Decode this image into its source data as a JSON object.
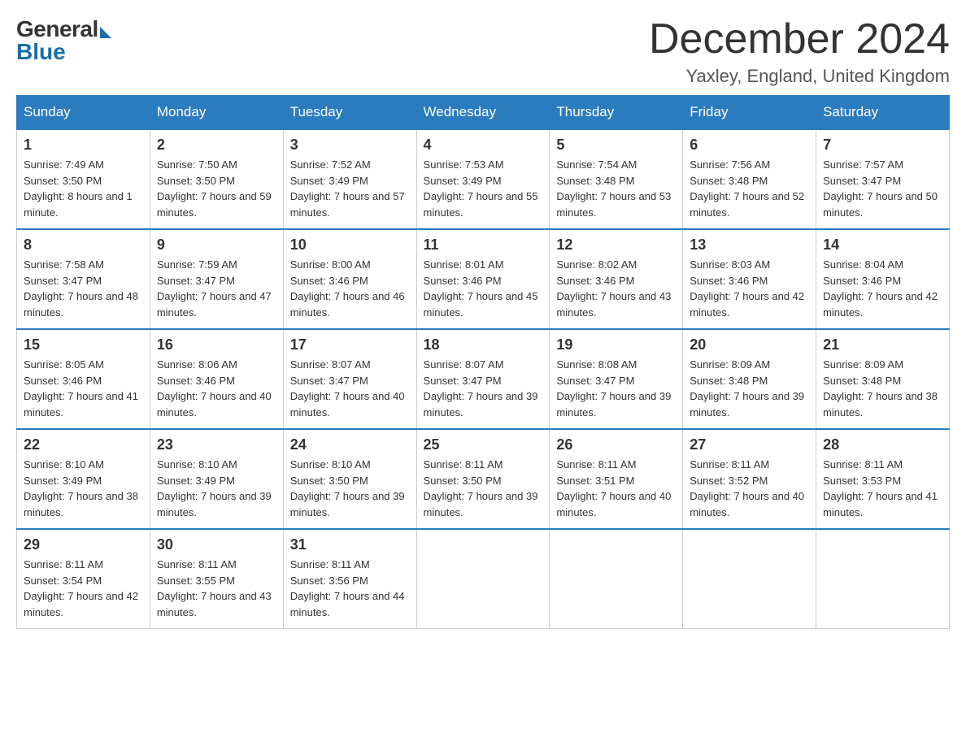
{
  "logo": {
    "general": "General",
    "blue": "Blue"
  },
  "title": "December 2024",
  "location": "Yaxley, England, United Kingdom",
  "days_of_week": [
    "Sunday",
    "Monday",
    "Tuesday",
    "Wednesday",
    "Thursday",
    "Friday",
    "Saturday"
  ],
  "weeks": [
    [
      {
        "num": "1",
        "sunrise": "7:49 AM",
        "sunset": "3:50 PM",
        "daylight": "8 hours and 1 minute."
      },
      {
        "num": "2",
        "sunrise": "7:50 AM",
        "sunset": "3:50 PM",
        "daylight": "7 hours and 59 minutes."
      },
      {
        "num": "3",
        "sunrise": "7:52 AM",
        "sunset": "3:49 PM",
        "daylight": "7 hours and 57 minutes."
      },
      {
        "num": "4",
        "sunrise": "7:53 AM",
        "sunset": "3:49 PM",
        "daylight": "7 hours and 55 minutes."
      },
      {
        "num": "5",
        "sunrise": "7:54 AM",
        "sunset": "3:48 PM",
        "daylight": "7 hours and 53 minutes."
      },
      {
        "num": "6",
        "sunrise": "7:56 AM",
        "sunset": "3:48 PM",
        "daylight": "7 hours and 52 minutes."
      },
      {
        "num": "7",
        "sunrise": "7:57 AM",
        "sunset": "3:47 PM",
        "daylight": "7 hours and 50 minutes."
      }
    ],
    [
      {
        "num": "8",
        "sunrise": "7:58 AM",
        "sunset": "3:47 PM",
        "daylight": "7 hours and 48 minutes."
      },
      {
        "num": "9",
        "sunrise": "7:59 AM",
        "sunset": "3:47 PM",
        "daylight": "7 hours and 47 minutes."
      },
      {
        "num": "10",
        "sunrise": "8:00 AM",
        "sunset": "3:46 PM",
        "daylight": "7 hours and 46 minutes."
      },
      {
        "num": "11",
        "sunrise": "8:01 AM",
        "sunset": "3:46 PM",
        "daylight": "7 hours and 45 minutes."
      },
      {
        "num": "12",
        "sunrise": "8:02 AM",
        "sunset": "3:46 PM",
        "daylight": "7 hours and 43 minutes."
      },
      {
        "num": "13",
        "sunrise": "8:03 AM",
        "sunset": "3:46 PM",
        "daylight": "7 hours and 42 minutes."
      },
      {
        "num": "14",
        "sunrise": "8:04 AM",
        "sunset": "3:46 PM",
        "daylight": "7 hours and 42 minutes."
      }
    ],
    [
      {
        "num": "15",
        "sunrise": "8:05 AM",
        "sunset": "3:46 PM",
        "daylight": "7 hours and 41 minutes."
      },
      {
        "num": "16",
        "sunrise": "8:06 AM",
        "sunset": "3:46 PM",
        "daylight": "7 hours and 40 minutes."
      },
      {
        "num": "17",
        "sunrise": "8:07 AM",
        "sunset": "3:47 PM",
        "daylight": "7 hours and 40 minutes."
      },
      {
        "num": "18",
        "sunrise": "8:07 AM",
        "sunset": "3:47 PM",
        "daylight": "7 hours and 39 minutes."
      },
      {
        "num": "19",
        "sunrise": "8:08 AM",
        "sunset": "3:47 PM",
        "daylight": "7 hours and 39 minutes."
      },
      {
        "num": "20",
        "sunrise": "8:09 AM",
        "sunset": "3:48 PM",
        "daylight": "7 hours and 39 minutes."
      },
      {
        "num": "21",
        "sunrise": "8:09 AM",
        "sunset": "3:48 PM",
        "daylight": "7 hours and 38 minutes."
      }
    ],
    [
      {
        "num": "22",
        "sunrise": "8:10 AM",
        "sunset": "3:49 PM",
        "daylight": "7 hours and 38 minutes."
      },
      {
        "num": "23",
        "sunrise": "8:10 AM",
        "sunset": "3:49 PM",
        "daylight": "7 hours and 39 minutes."
      },
      {
        "num": "24",
        "sunrise": "8:10 AM",
        "sunset": "3:50 PM",
        "daylight": "7 hours and 39 minutes."
      },
      {
        "num": "25",
        "sunrise": "8:11 AM",
        "sunset": "3:50 PM",
        "daylight": "7 hours and 39 minutes."
      },
      {
        "num": "26",
        "sunrise": "8:11 AM",
        "sunset": "3:51 PM",
        "daylight": "7 hours and 40 minutes."
      },
      {
        "num": "27",
        "sunrise": "8:11 AM",
        "sunset": "3:52 PM",
        "daylight": "7 hours and 40 minutes."
      },
      {
        "num": "28",
        "sunrise": "8:11 AM",
        "sunset": "3:53 PM",
        "daylight": "7 hours and 41 minutes."
      }
    ],
    [
      {
        "num": "29",
        "sunrise": "8:11 AM",
        "sunset": "3:54 PM",
        "daylight": "7 hours and 42 minutes."
      },
      {
        "num": "30",
        "sunrise": "8:11 AM",
        "sunset": "3:55 PM",
        "daylight": "7 hours and 43 minutes."
      },
      {
        "num": "31",
        "sunrise": "8:11 AM",
        "sunset": "3:56 PM",
        "daylight": "7 hours and 44 minutes."
      },
      null,
      null,
      null,
      null
    ]
  ]
}
